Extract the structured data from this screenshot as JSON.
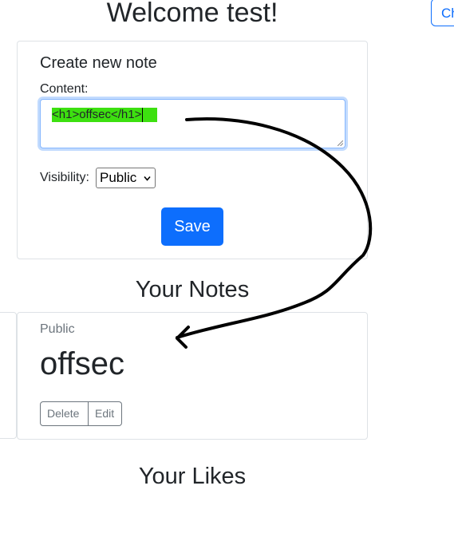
{
  "header": {
    "welcome_text": "Welcome test!",
    "top_right_button_label": "Ch"
  },
  "create_note": {
    "title": "Create new note",
    "content_label": "Content:",
    "content_value": "<h1>offsec</h1>",
    "visibility_label": "Visibility:",
    "visibility_selected": "Public",
    "save_label": "Save"
  },
  "notes_section": {
    "heading": "Your Notes",
    "notes": [
      {
        "visibility": "Public",
        "content": "offsec",
        "delete_label": "Delete",
        "edit_label": "Edit"
      }
    ]
  },
  "likes_section": {
    "heading": "Your Likes"
  },
  "colors": {
    "primary": "#0d6efd",
    "highlight": "#3de010",
    "border": "#dee2e6",
    "muted": "#6c757d",
    "annotation_stroke": "#000000"
  },
  "icons": {
    "select_arrow": "chevron-down-icon",
    "textarea_resize": "resize-grip-icon",
    "annotation_arrow": "curved-arrow-icon"
  }
}
